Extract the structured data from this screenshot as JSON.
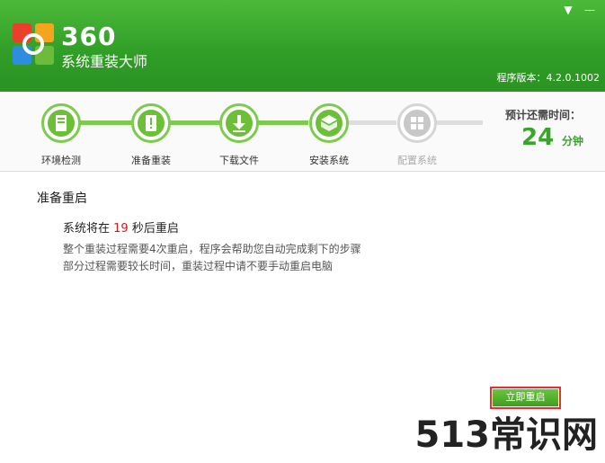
{
  "app": {
    "logo_number": "360",
    "logo_subtitle": "系统重装大师",
    "version_text": "程序版本：4.2.0.1002"
  },
  "window_controls": {
    "menu_glyph": "▼",
    "minimize_glyph": "—"
  },
  "steps": [
    {
      "label": "环境检测",
      "icon": "monitor-icon",
      "state": "done"
    },
    {
      "label": "准备重装",
      "icon": "prepare-icon",
      "state": "done"
    },
    {
      "label": "下载文件",
      "icon": "download-icon",
      "state": "done"
    },
    {
      "label": "安装系统",
      "icon": "install-icon",
      "state": "done"
    },
    {
      "label": "配置系统",
      "icon": "windows-logo-icon",
      "state": "pending"
    }
  ],
  "eta": {
    "label": "预计还需时间：",
    "value": "24",
    "unit": "分钟"
  },
  "main": {
    "title": "准备重启",
    "countdown_prefix": "系统将在 ",
    "countdown_seconds": "19",
    "countdown_suffix": " 秒后重启",
    "info_line1": "整个重装过程需要4次重启，程序会帮助您自动完成剩下的步骤",
    "info_line2": "部分过程需要较长时间，重装过程中请不要手动重启电脑"
  },
  "restart_button": "立即重启",
  "watermark": "513常识网",
  "colors": {
    "brand_green": "#3aa52a",
    "countdown_red": "#d11a1a",
    "highlight_border": "#e53030"
  }
}
